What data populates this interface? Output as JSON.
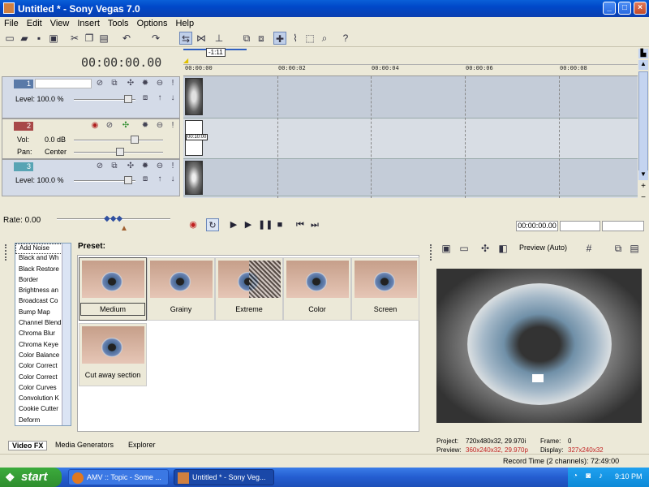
{
  "window": {
    "title": "Untitled * - Sony Vegas 7.0",
    "minimize": "_",
    "maximize": "□",
    "close": "×"
  },
  "menu": [
    "File",
    "Edit",
    "View",
    "Insert",
    "Tools",
    "Options",
    "Help"
  ],
  "timeline": {
    "timecode": "00:00:00.00",
    "ruler_marker": "-1:11",
    "ticks": [
      "00:00:00",
      "00:00:02",
      "00:00:04",
      "00:00:06",
      "00:00:08"
    ],
    "clip_label": "00:10:00",
    "tracks": [
      {
        "number": "1",
        "type": "video",
        "level_label": "Level: 100.0 %",
        "color": "#5a7aa8"
      },
      {
        "number": "2",
        "type": "audio",
        "vol_label": "Vol:",
        "vol_value": "0.0 dB",
        "pan_label": "Pan:",
        "pan_value": "Center",
        "color": "#a84848"
      },
      {
        "number": "3",
        "type": "video",
        "level_label": "Level: 100.0 %",
        "color": "#58a4b4"
      }
    ]
  },
  "transport": {
    "rate": "Rate: 0.00",
    "position": "00:00:00.00"
  },
  "fx": {
    "preset_label": "Preset:",
    "list": [
      "Add Noise",
      "Black and Wh",
      "Black Restore",
      "Border",
      "Brightness an",
      "Broadcast Co",
      "Bump Map",
      "Channel Blend",
      "Chroma Blur",
      "Chroma Keye",
      "Color Balance",
      "Color Correct",
      "Color Correct",
      "Color Curves",
      "Convolution K",
      "Cookie Cutter",
      "Deform"
    ],
    "selected": "Add Noise",
    "presets": [
      "Medium",
      "Grainy",
      "Extreme",
      "Color",
      "Screen",
      "Cut away section"
    ],
    "tabs": [
      "Video FX",
      "Media Generators",
      "Explorer"
    ]
  },
  "preview": {
    "mode": "Preview (Auto)",
    "project_label": "Project:",
    "project_value": "720x480x32, 29.970i",
    "preview_label": "Preview:",
    "preview_value": "360x240x32, 29.970p",
    "frame_label": "Frame:",
    "frame_value": "0",
    "display_label": "Display:",
    "display_value": "327x240x32"
  },
  "status": {
    "record_time": "Record Time (2 channels): 72:49:00"
  },
  "taskbar": {
    "start": "start",
    "tasks": [
      "AMV :: Topic - Some ...",
      "Untitled * - Sony Veg..."
    ],
    "clock": "9:10 PM"
  },
  "colors": {
    "title_bar": "#0a5fd8",
    "taskbar": "#245dd0",
    "start": "#3cab3c"
  }
}
